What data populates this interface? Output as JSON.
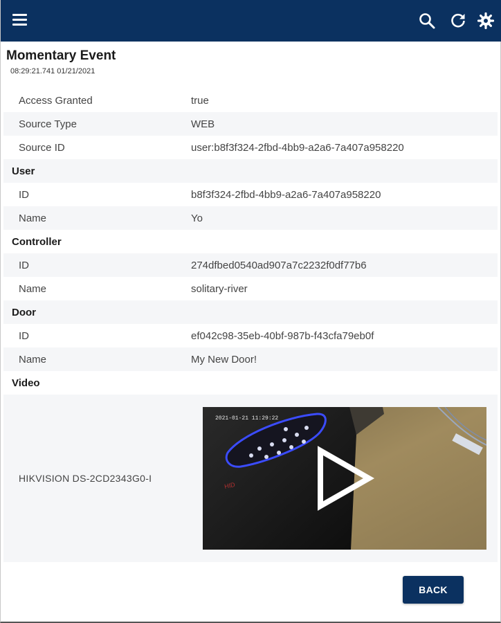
{
  "header": {
    "menu_icon": "hamburger-menu-icon",
    "actions": [
      "search-icon",
      "refresh-icon",
      "settings-gear-icon"
    ],
    "background": "#0b3160"
  },
  "event": {
    "title": "Momentary Event",
    "timestamp": "08:29:21.741 01/21/2021"
  },
  "general": [
    {
      "label": "Access Granted",
      "value": "true"
    },
    {
      "label": "Source Type",
      "value": "WEB"
    },
    {
      "label": "Source ID",
      "value": "user:b8f3f324-2fbd-4bb9-a2a6-7a407a958220"
    }
  ],
  "user": {
    "heading": "User",
    "fields": [
      {
        "label": "ID",
        "value": "b8f3f324-2fbd-4bb9-a2a6-7a407a958220"
      },
      {
        "label": "Name",
        "value": "Yo"
      }
    ]
  },
  "controller": {
    "heading": "Controller",
    "fields": [
      {
        "label": "ID",
        "value": "274dfbed0540ad907a7c2232f0df77b6"
      },
      {
        "label": "Name",
        "value": "solitary-river"
      }
    ]
  },
  "door": {
    "heading": "Door",
    "fields": [
      {
        "label": "ID",
        "value": "ef042c98-35eb-40bf-987b-f43cfa79eb0f"
      },
      {
        "label": "Name",
        "value": "My New Door!"
      }
    ]
  },
  "video": {
    "heading": "Video",
    "camera_name": "HIKVISION DS-2CD2343G0-I",
    "overlay_timestamp": "2021-01-21 11:29:22",
    "device_label": "HID",
    "play_icon": "play-icon"
  },
  "actions": {
    "back_label": "BACK"
  }
}
